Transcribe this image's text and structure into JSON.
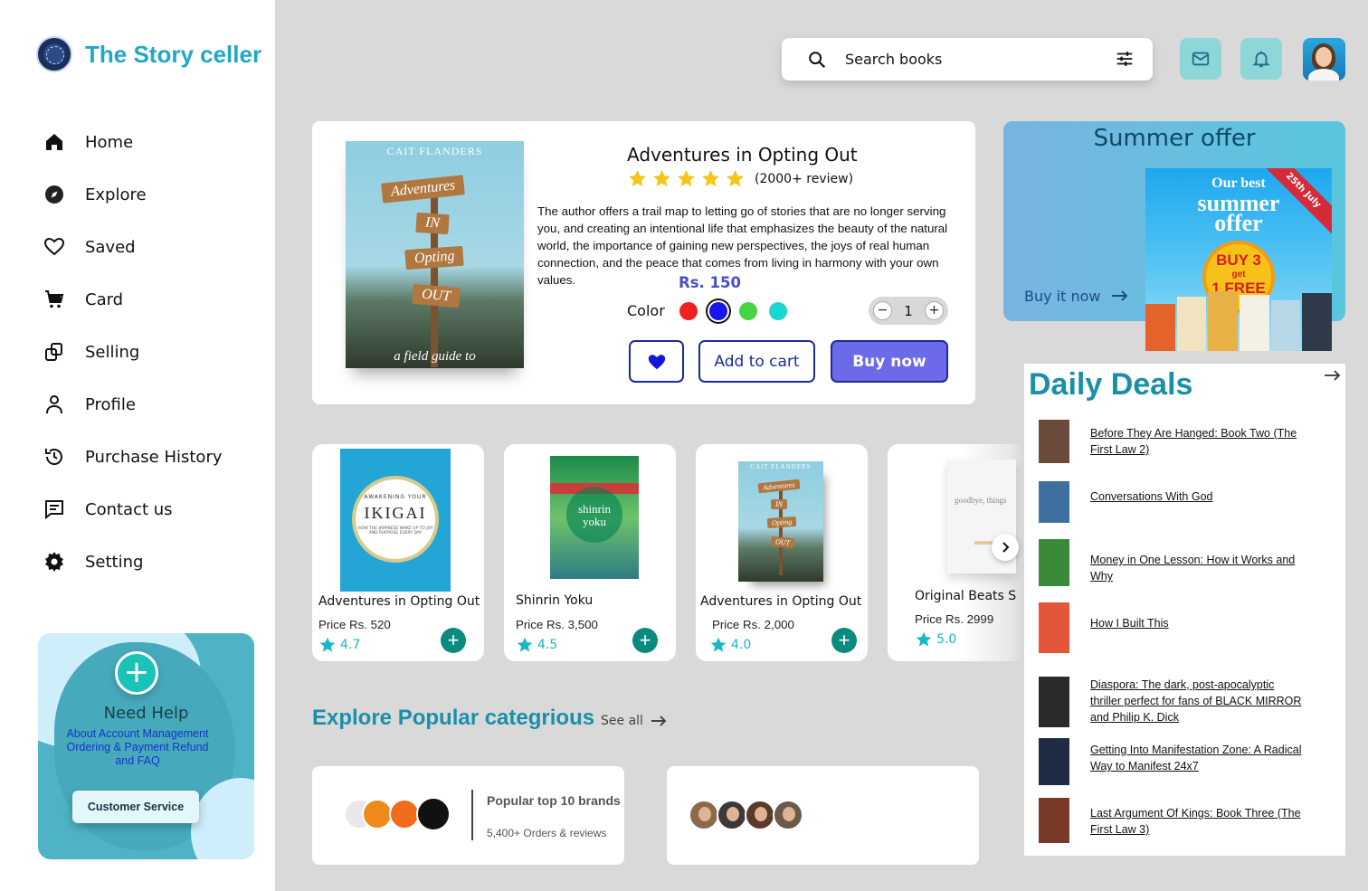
{
  "brand": {
    "title": "The Story celler"
  },
  "nav": [
    {
      "label": "Home",
      "icon": "home-icon"
    },
    {
      "label": "Explore",
      "icon": "compass-icon"
    },
    {
      "label": "Saved",
      "icon": "heart-icon"
    },
    {
      "label": "Card",
      "icon": "cart-icon"
    },
    {
      "label": "Selling",
      "icon": "copy-icon"
    },
    {
      "label": "Profile",
      "icon": "user-icon"
    },
    {
      "label": "Purchase History",
      "icon": "history-icon"
    },
    {
      "label": "Contact us",
      "icon": "chat-icon"
    },
    {
      "label": "Setting",
      "icon": "gear-icon"
    }
  ],
  "help": {
    "title": "Need Help",
    "text": "About Account Management Ordering & Payment Refund and FAQ",
    "button": "Customer Service"
  },
  "search": {
    "placeholder": "Search books"
  },
  "featured": {
    "cover_author": "CAIT FLANDERS",
    "cover_words": [
      "Adventures",
      "IN",
      "Opting",
      "OUT"
    ],
    "cover_subtitle": "a field guide to",
    "title": "Adventures in Opting Out",
    "stars": 5,
    "review": "(2000+ review)",
    "description": "The author offers a trail map to letting go of stories that are no longer serving you, and creating an intentional life that emphasizes the beauty of the natural world, the importance of gaining new perspectives, the joys of real human connection, and the peace that comes from living in harmony with your own values.",
    "price": "Rs. 150",
    "color_label": "Color",
    "colors": [
      "#ee2020",
      "#1616e8",
      "#44d444",
      "#18d6d0"
    ],
    "selected_color": 1,
    "quantity": "1",
    "add_to_cart": "Add to cart",
    "buy_now": "Buy now"
  },
  "summer": {
    "title": "Summer offer",
    "buy": "Buy it now",
    "poster_line1": "Our best",
    "poster_line2": "summer",
    "poster_line3": "offer",
    "badge_line1": "BUY 3",
    "badge_line2": "get",
    "badge_line3": "1 FREE",
    "corner": "25th July"
  },
  "books": [
    {
      "title": "Adventures in Opting Out",
      "price": "Price Rs. 520",
      "rating": "4.7",
      "cover": {
        "top": "AWAKENING YOUR",
        "name": "IKIGAI",
        "sub": "HOW THE JAPANESE WAKE UP TO JOY AND PURPOSE EVERY DAY"
      }
    },
    {
      "title": "Shinrin Yoku",
      "price": "Price Rs. 3,500",
      "rating": "4.5",
      "cover": {
        "name": "shinrin yoku"
      }
    },
    {
      "title": "Adventures in Opting Out",
      "price": "Price Rs. 2,000",
      "rating": "4.0",
      "cover": {
        "top": "CAIT FLANDERS"
      }
    },
    {
      "title": "Original Beats S",
      "price": "Price Rs. 2999",
      "rating": "5.0",
      "cover": {
        "name": "goodbye, things"
      }
    }
  ],
  "explore": {
    "title": "Explore Popular categrious",
    "see_all": "See all",
    "brands_title": "Popular top 10 brands",
    "brands_sub": "5,400+ Orders & reviews"
  },
  "deals": {
    "title": "Daily Deals",
    "items": [
      {
        "title": "Before They Are Hanged: Book Two (The First Law 2)",
        "color": "#6b4a3a"
      },
      {
        "title": "Conversations With God",
        "color": "#3f6f9e"
      },
      {
        "title": "Money in One Lesson: How it Works and Why",
        "color": "#3a8a3a"
      },
      {
        "title": "How I Built This",
        "color": "#e4553a"
      },
      {
        "title": "Diaspora: The dark, post-apocalyptic thriller perfect for fans of BLACK MIRROR and Philip K. Dick",
        "color": "#2a2a2a"
      },
      {
        "title": "Getting Into Manifestation Zone: A Radical Way to Manifest 24x7",
        "color": "#1f2a44"
      },
      {
        "title": "Last Argument Of Kings: Book Three (The First Law 3)",
        "color": "#7a3a2a"
      }
    ]
  }
}
